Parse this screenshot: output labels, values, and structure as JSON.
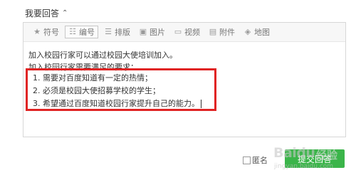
{
  "header": {
    "title": "我要回答",
    "caret_icon": "chevron-up-icon"
  },
  "toolbar": {
    "items": [
      {
        "label": "符号",
        "icon": "star-icon"
      },
      {
        "label": "编号",
        "icon": "numbered-list-icon",
        "active": true
      },
      {
        "label": "排版",
        "icon": "align-icon"
      },
      {
        "label": "图片",
        "icon": "image-icon"
      },
      {
        "label": "视频",
        "icon": "video-icon"
      },
      {
        "label": "附件",
        "icon": "attachment-icon"
      },
      {
        "label": "地图",
        "icon": "map-icon"
      }
    ]
  },
  "content": {
    "lines": [
      "加入校园行家可以通过校园大使培训加入。",
      "加入校园行家需要满足的要求："
    ],
    "requirements": [
      "1.  需要对百度知道有一定的热情；",
      "2.  必须是校园大使招募学校的学生；",
      "3.  希望通过百度知道校园行家提升自己的能力。"
    ],
    "highlight_color": "#e02424"
  },
  "footer": {
    "anonymous_label": "匿名",
    "anonymous_checked": false,
    "submit_label": "提交回答",
    "accent_color": "#3bb54a"
  },
  "watermark": {
    "brand": "Baidu",
    "suffix": "经验",
    "domain": "jingyan.baidu.com"
  }
}
